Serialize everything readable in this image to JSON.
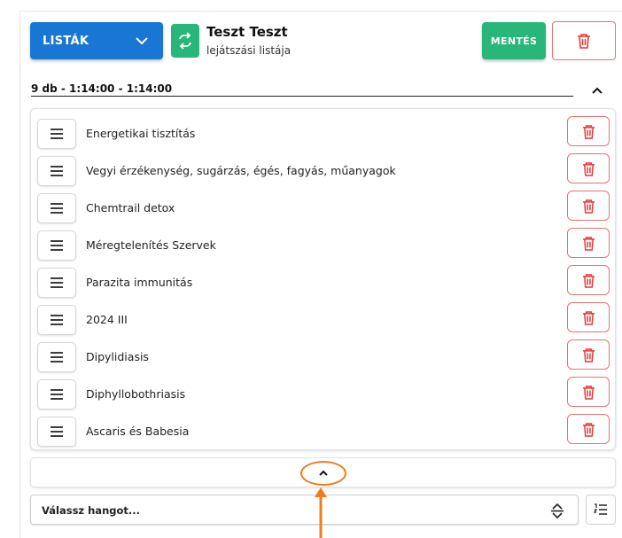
{
  "header": {
    "lists_label": "LISTÁK",
    "title": "Teszt Teszt",
    "subtitle": "lejátszási listája",
    "save_label": "MENTÉS"
  },
  "summary": "9 db - 1:14:00 - 1:14:00",
  "items": [
    {
      "label": "Energetikai tisztítás"
    },
    {
      "label": "Vegyi érzékenység, sugárzás, égés, fagyás, műanyagok"
    },
    {
      "label": "Chemtrail detox"
    },
    {
      "label": "Méregtelenítés Szervek"
    },
    {
      "label": "Parazita immunitás"
    },
    {
      "label": "2024 III"
    },
    {
      "label": "Dipylidiasis"
    },
    {
      "label": "Diphyllobothriasis"
    },
    {
      "label": "Ascaris és Babesia"
    }
  ],
  "sound_select": {
    "placeholder": "Válassz hangot..."
  },
  "colors": {
    "primary": "#1976d2",
    "success": "#28b67a",
    "danger": "#e53935",
    "annotation": "#f07b1b"
  },
  "icons": {
    "swap": "swap-icon",
    "trash": "trash-icon",
    "drag": "menu-icon",
    "chevron_up": "chevron-up-icon",
    "chevron_down": "chevron-down-icon",
    "sort": "sort-icon",
    "unfold": "unfold-icon"
  }
}
